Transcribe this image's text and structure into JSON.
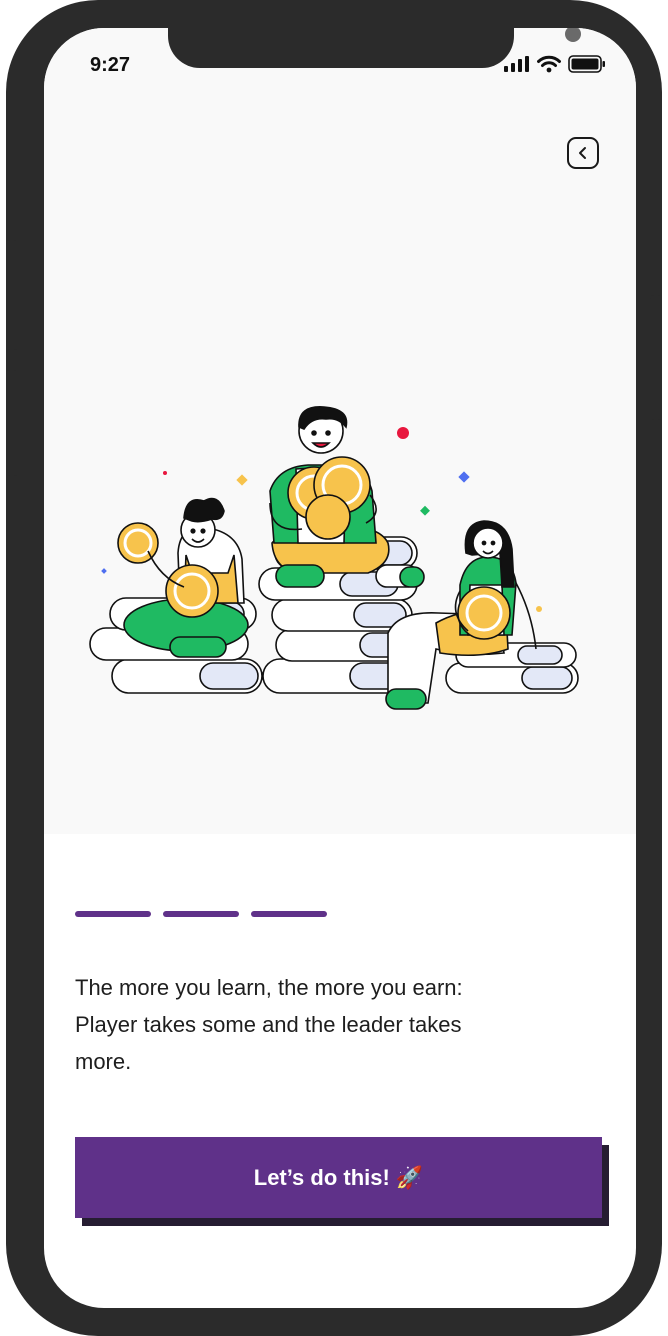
{
  "status_bar": {
    "time": "9:27"
  },
  "onboarding": {
    "body_text": "The more you learn, the more you earn: Player takes some and the leader takes more.",
    "cta_label": "Let’s do this!",
    "cta_emoji": "🚀",
    "progress_steps": 3,
    "active_steps": 3
  },
  "icons": {
    "back": "chevron-left-icon",
    "signal": "cellular-signal-icon",
    "wifi": "wifi-icon",
    "battery": "battery-icon",
    "cta_emoji": "rocket-icon"
  },
  "colors": {
    "accent": "#5f3189",
    "cta_shadow": "#261d32",
    "hero_bg": "#f9f9f9",
    "coin": "#f7c34c",
    "green": "#1fba62",
    "device": "#2b2b2b"
  }
}
